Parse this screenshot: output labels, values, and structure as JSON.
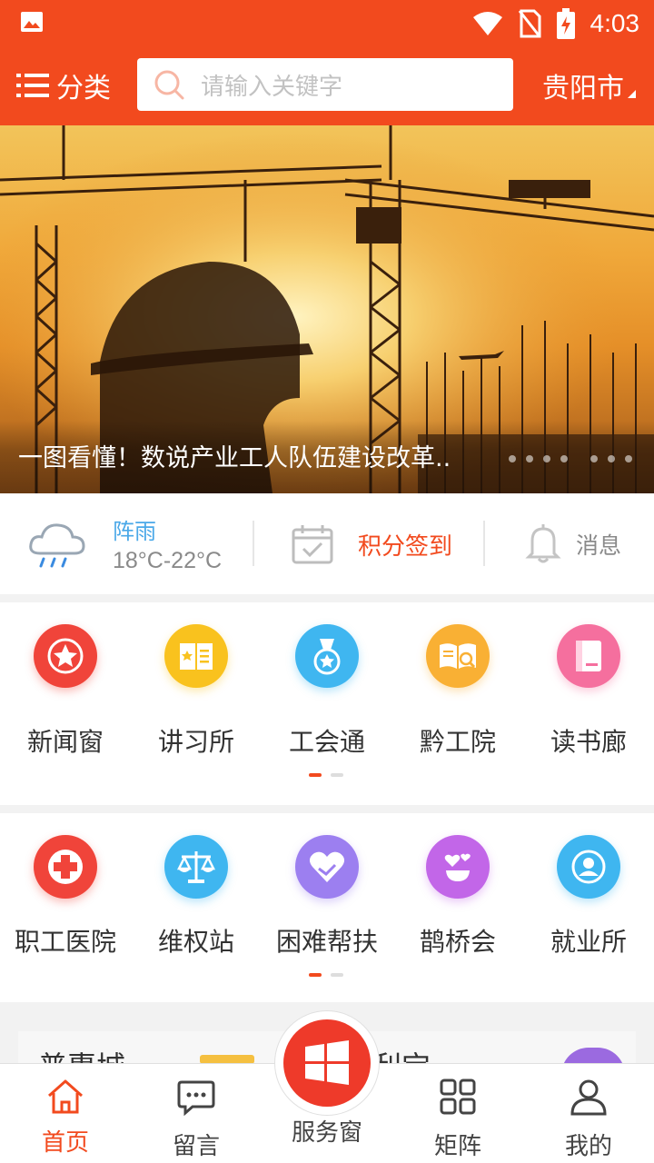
{
  "status_bar": {
    "time": "4:03"
  },
  "header": {
    "category_label": "分类",
    "search_placeholder": "请输入关键字",
    "city": "贵阳市"
  },
  "banner": {
    "caption": "一图看懂！数说产业工人队伍建设改革..",
    "dot_count": 7
  },
  "info": {
    "weather_condition": "阵雨",
    "weather_temp": "18°C-22°C",
    "signin_label": "积分签到",
    "message_label": "消息"
  },
  "grid1": {
    "items": [
      {
        "label": "新闻窗",
        "icon": "star-icon",
        "color": "#f0443a"
      },
      {
        "label": "讲习所",
        "icon": "book-star-icon",
        "color": "#f9c21e"
      },
      {
        "label": "工会通",
        "icon": "medal-icon",
        "color": "#3fb6f0"
      },
      {
        "label": "黔工院",
        "icon": "open-book-search-icon",
        "color": "#f9b034"
      },
      {
        "label": "读书廊",
        "icon": "notebook-icon",
        "color": "#f56f9e"
      }
    ]
  },
  "grid2": {
    "items": [
      {
        "label": "职工医院",
        "icon": "medical-cross-icon",
        "color": "#f0443a"
      },
      {
        "label": "维权站",
        "icon": "scales-icon",
        "color": "#3fb6f0"
      },
      {
        "label": "困难帮扶",
        "icon": "heart-hand-icon",
        "color": "#9c7ff0"
      },
      {
        "label": "鹊桥会",
        "icon": "hearts-cup-icon",
        "color": "#c266e8"
      },
      {
        "label": "就业所",
        "icon": "person-search-icon",
        "color": "#3fb6f0"
      }
    ]
  },
  "lower": {
    "left_title": "普惠城",
    "right_title": "利宝"
  },
  "tabbar": {
    "tabs": [
      {
        "label": "首页",
        "icon": "home-icon"
      },
      {
        "label": "留言",
        "icon": "chat-icon"
      },
      {
        "label": "服务窗",
        "icon": "windows-icon"
      },
      {
        "label": "矩阵",
        "icon": "grid-icon"
      },
      {
        "label": "我的",
        "icon": "user-icon"
      }
    ],
    "active_color": "#f24a1e"
  },
  "colors": {
    "brand": "#f24a1e"
  }
}
